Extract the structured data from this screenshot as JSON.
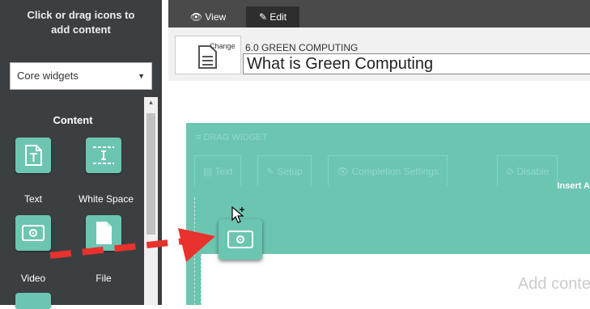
{
  "sidebar": {
    "title_line1": "Click or drag icons to",
    "title_line2": "add content",
    "select_value": "Core widgets",
    "section_heading": "Content",
    "widgets": [
      {
        "label": "Text",
        "icon": "text-widget-icon"
      },
      {
        "label": "White Space",
        "icon": "white-space-widget-icon"
      },
      {
        "label": "Video",
        "icon": "video-widget-icon"
      },
      {
        "label": "File",
        "icon": "file-widget-icon"
      }
    ]
  },
  "tabs": {
    "view_label": "View",
    "edit_label": "Edit"
  },
  "header": {
    "change_label": "Change",
    "section_number": "6.0 GREEN COMPUTING",
    "page_title": "What is Green Computing"
  },
  "dragzone": {
    "drag_label": "DRAG WIDGET",
    "toolbar": {
      "text_label": "Text",
      "setup_label": "Setup",
      "completion_label": "Completion Settings",
      "truncated_label": "Disable"
    },
    "insert_label": "Insert A",
    "add_content_label": "Add conte"
  },
  "colors": {
    "widget_teal": "#6cc5b1",
    "sidebar_bg": "#3c3f41",
    "arrow_red": "#e8322d"
  }
}
